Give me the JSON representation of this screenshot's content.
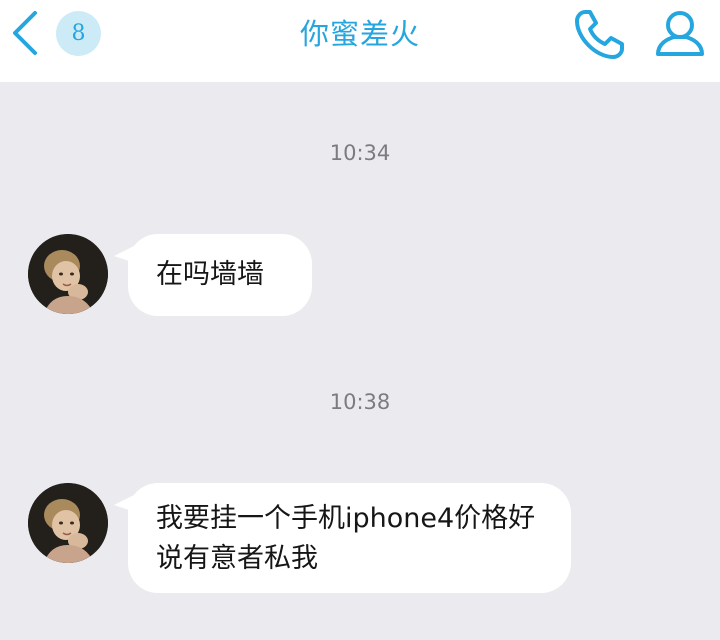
{
  "header": {
    "back_icon": "chevron-left-icon",
    "unread_count": "8",
    "title": "你蜜差火",
    "call_icon": "phone-icon",
    "profile_icon": "person-icon"
  },
  "colors": {
    "accent": "#26a6df",
    "badge_bg": "#cdebf7",
    "background": "#ebebef",
    "bubble": "#ffffff"
  },
  "messages": [
    {
      "time": "10:34",
      "text": "在吗墙墙"
    },
    {
      "time": "10:38",
      "text": "我要挂一个手机iphone4价格好说有意者私我"
    }
  ]
}
